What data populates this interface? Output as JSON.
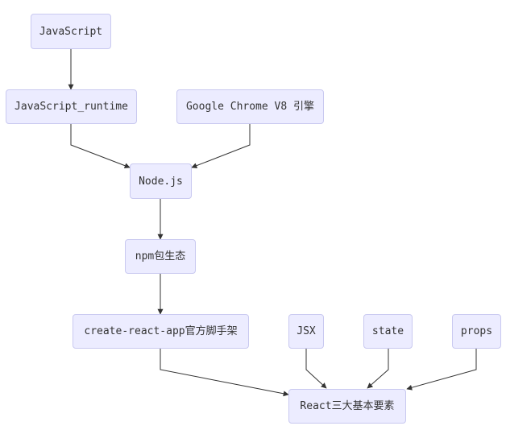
{
  "diagram": {
    "nodes": {
      "javascript": "JavaScript",
      "js_runtime": "JavaScript_runtime",
      "chrome_v8": "Google Chrome V8 引擎",
      "nodejs": "Node.js",
      "npm": "npm包生态",
      "cra": "create-react-app官方脚手架",
      "jsx": "JSX",
      "state": "state",
      "props": "props",
      "react": "React三大基本要素"
    },
    "edges": [
      [
        "javascript",
        "js_runtime"
      ],
      [
        "js_runtime",
        "nodejs"
      ],
      [
        "chrome_v8",
        "nodejs"
      ],
      [
        "nodejs",
        "npm"
      ],
      [
        "npm",
        "cra"
      ],
      [
        "cra",
        "react"
      ],
      [
        "jsx",
        "react"
      ],
      [
        "state",
        "react"
      ],
      [
        "props",
        "react"
      ]
    ],
    "colors": {
      "node_fill": "#ececff",
      "node_border": "#c9c9f0",
      "edge": "#333333",
      "text": "#333333"
    }
  }
}
